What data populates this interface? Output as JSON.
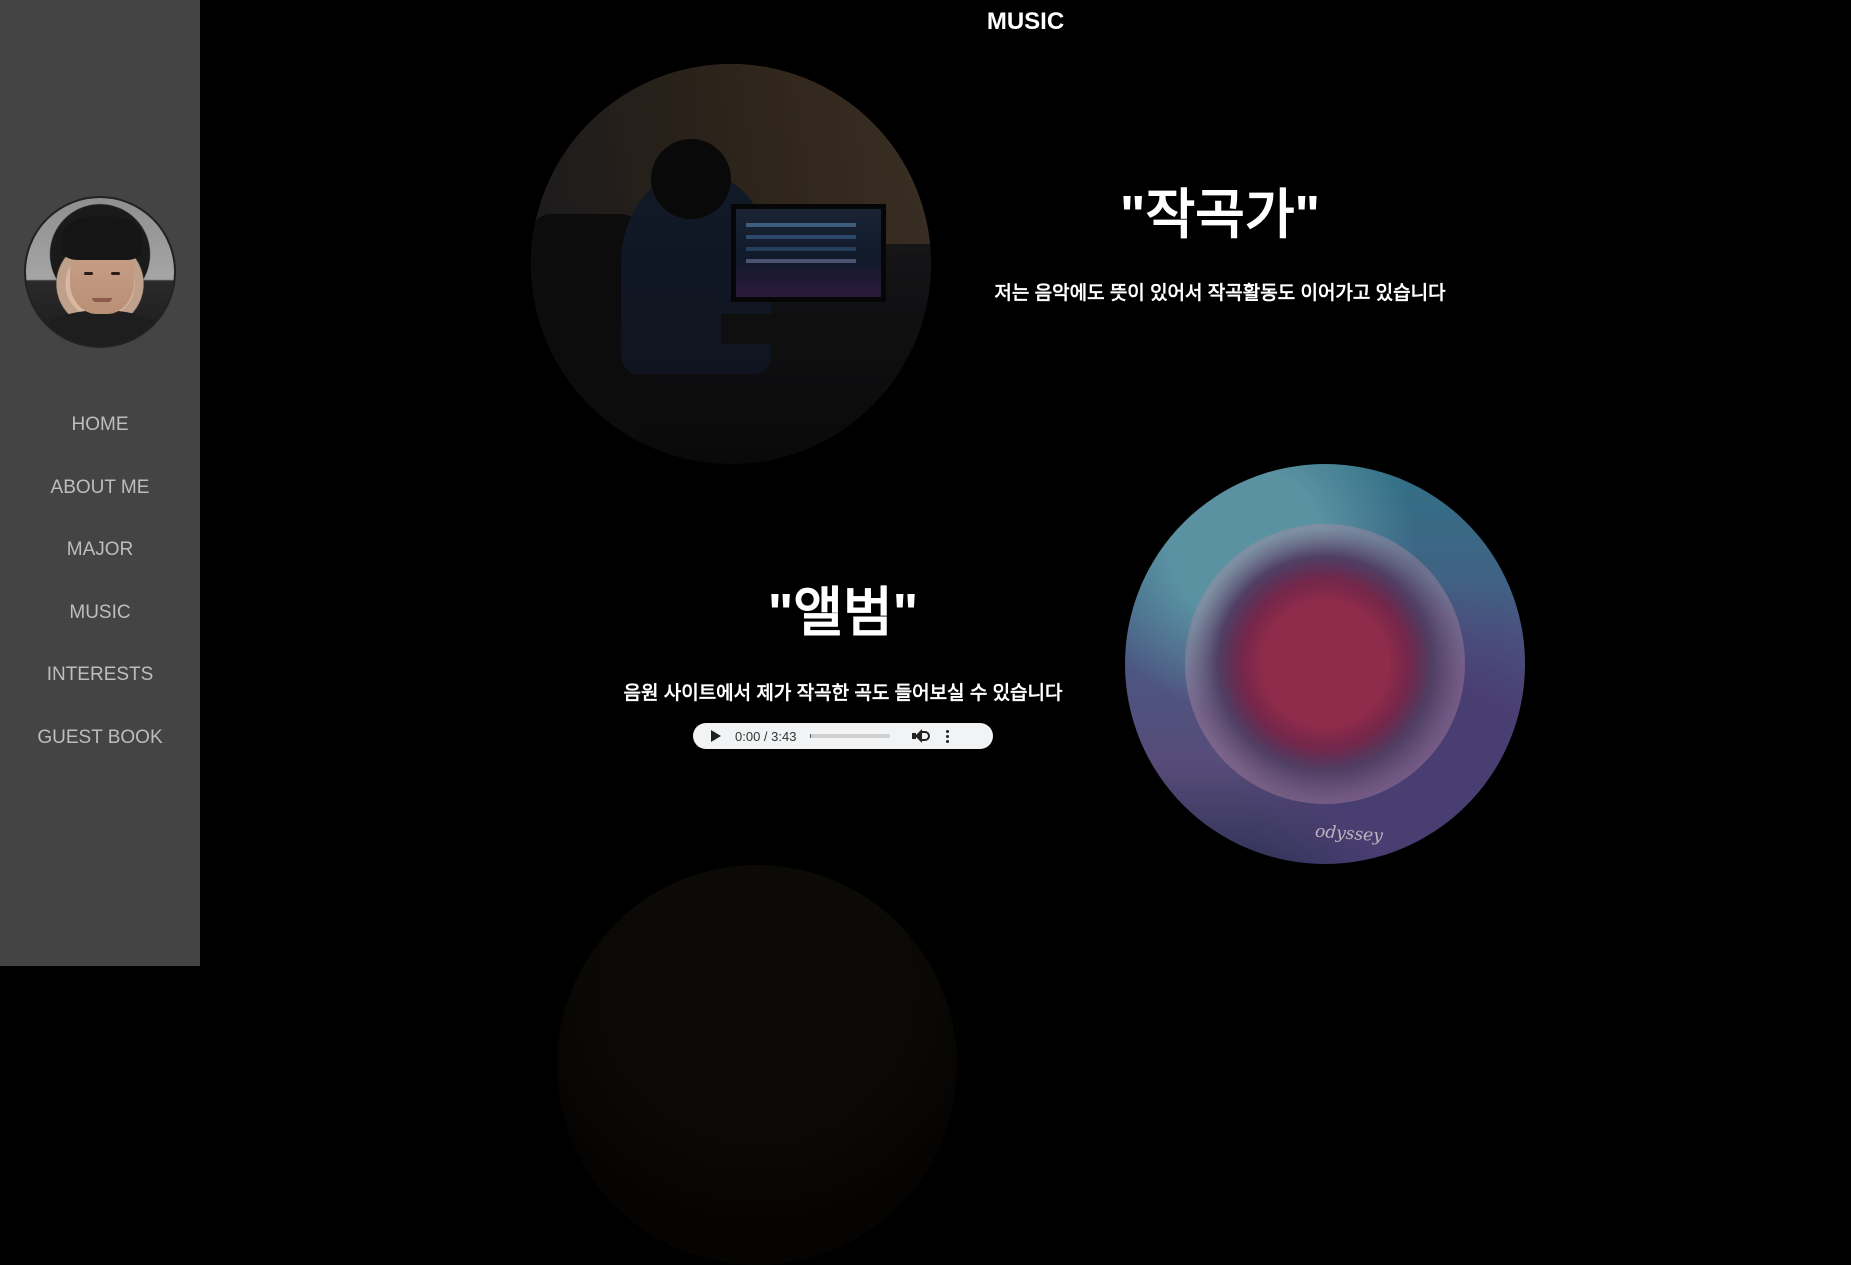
{
  "sidebar": {
    "nav": [
      "HOME",
      "ABOUT ME",
      "MAJOR",
      "MUSIC",
      "INTERESTS",
      "GUEST BOOK"
    ]
  },
  "page": {
    "title": "MUSIC"
  },
  "composer": {
    "title": "\"작곡가\"",
    "text": "저는 음악에도 뜻이 있어서 작곡활동도 이어가고 있습니다"
  },
  "album": {
    "title": "\"앨범\"",
    "text": "음원 사이트에서 제가 작곡한 곡도 들어보실 수 있습니다",
    "caption": "odyssey"
  },
  "audio": {
    "time": "0:00 / 3:43",
    "progress": 0.0
  },
  "colors": {
    "background": "#000000",
    "sidebar": "#444444",
    "nav_text": "#bdbdbd",
    "text": "#ffffff"
  }
}
